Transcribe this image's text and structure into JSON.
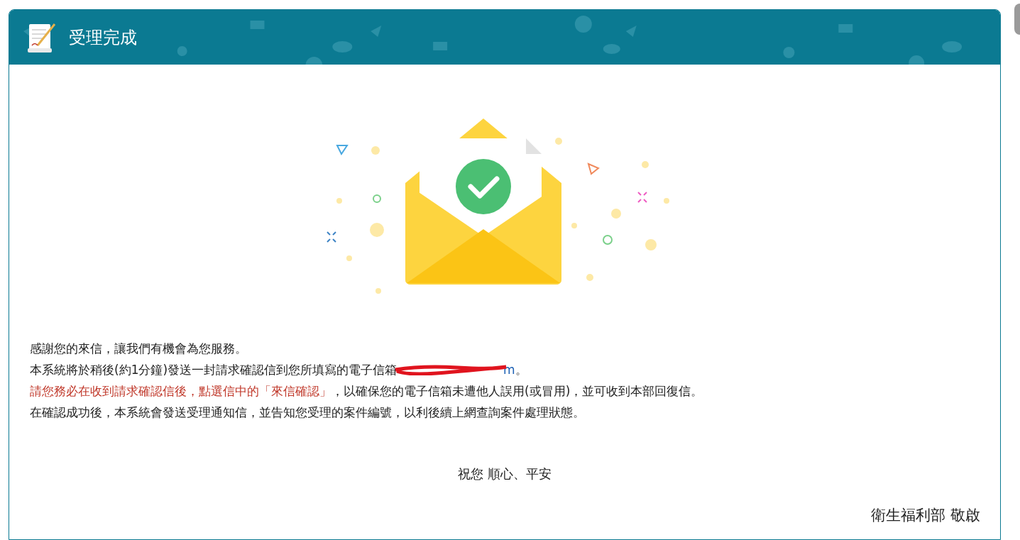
{
  "header": {
    "title": "受理完成"
  },
  "lines": [
    {
      "segments": [
        {
          "kind": "plain",
          "text": "感謝您的來信，讓我們有機會為您服務。"
        }
      ]
    },
    {
      "segments": [
        {
          "kind": "plain",
          "text": "本系統將於稍後(約1分鐘)發送一封請求確認信到您所填寫的電子信箱"
        },
        {
          "kind": "redacted_email",
          "text": "m"
        },
        {
          "kind": "plain",
          "text": "。"
        }
      ]
    },
    {
      "segments": [
        {
          "kind": "alert",
          "text": "請您務必在收到請求確認信後，點選信中的「來信確認」"
        },
        {
          "kind": "plain",
          "text": "，以確保您的電子信箱未遭他人誤用(或冒用)，並可收到本部回復信。"
        }
      ]
    },
    {
      "segments": [
        {
          "kind": "plain",
          "text": "在確認成功後，本系統會發送受理通知信，並告知您受理的案件編號，以利後續上網查詢案件處理狀態。"
        }
      ]
    }
  ],
  "greeting": "祝您 順心、平安",
  "signature": "衛生福利部 敬啟"
}
